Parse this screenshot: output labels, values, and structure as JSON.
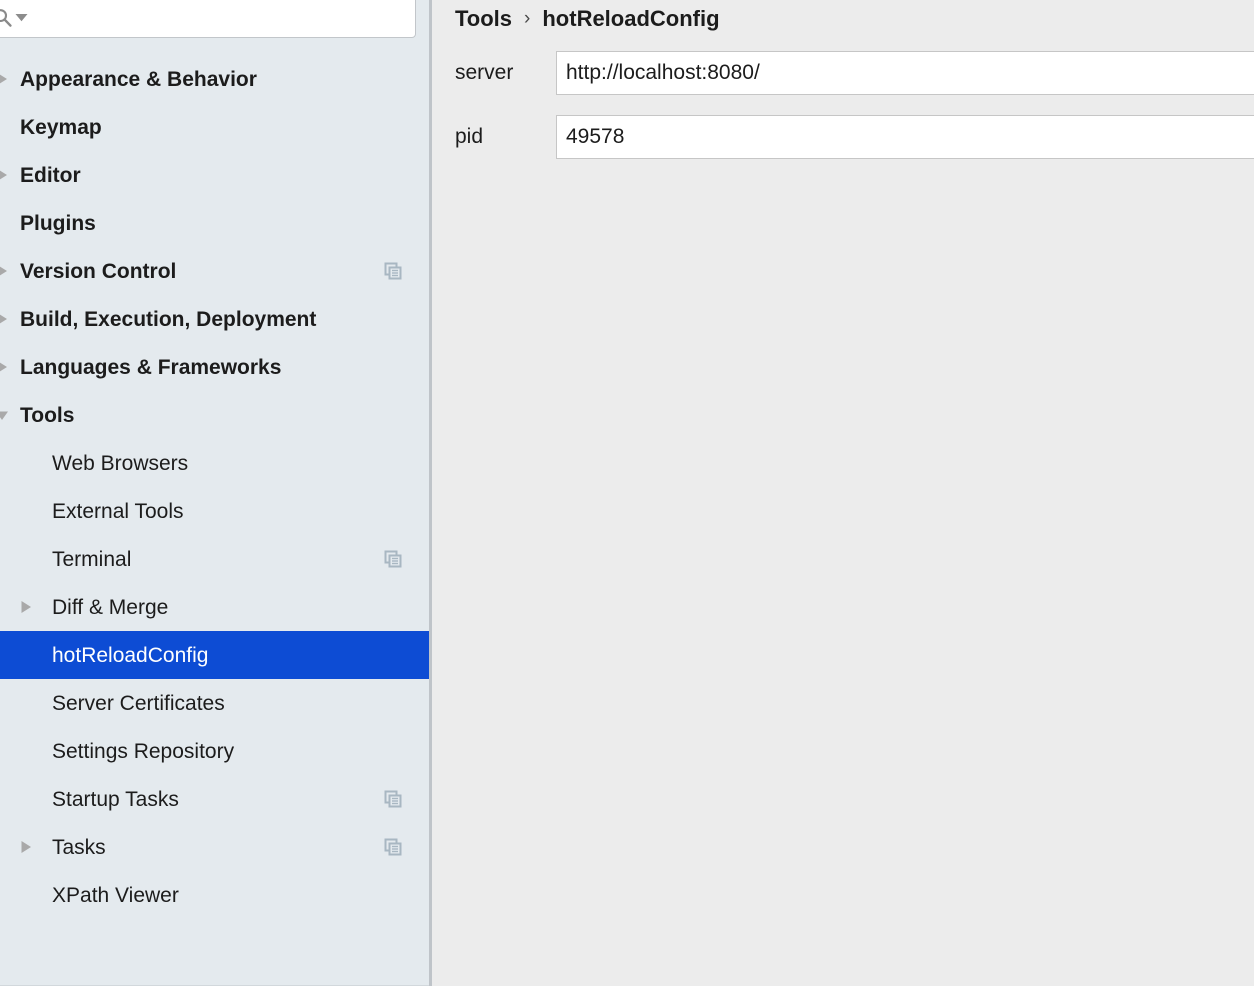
{
  "search": {
    "icon": "search-icon",
    "dropdown_icon": "chevron-down-icon",
    "value": "",
    "placeholder": ""
  },
  "sidebar": {
    "items": [
      {
        "label": "Appearance & Behavior",
        "level": "top",
        "twisty": "collapsed-clipped",
        "scope_icon": false,
        "selected": false
      },
      {
        "label": "Keymap",
        "level": "top",
        "twisty": "none",
        "scope_icon": false,
        "selected": false
      },
      {
        "label": "Editor",
        "level": "top",
        "twisty": "collapsed-clipped",
        "scope_icon": false,
        "selected": false
      },
      {
        "label": "Plugins",
        "level": "top",
        "twisty": "none",
        "scope_icon": false,
        "selected": false
      },
      {
        "label": "Version Control",
        "level": "top",
        "twisty": "collapsed-clipped",
        "scope_icon": true,
        "selected": false
      },
      {
        "label": "Build, Execution, Deployment",
        "level": "top",
        "twisty": "collapsed-clipped",
        "scope_icon": false,
        "selected": false
      },
      {
        "label": "Languages & Frameworks",
        "level": "top",
        "twisty": "collapsed-clipped",
        "scope_icon": false,
        "selected": false
      },
      {
        "label": "Tools",
        "level": "top",
        "twisty": "expanded-clipped",
        "scope_icon": false,
        "selected": false
      },
      {
        "label": "Web Browsers",
        "level": "child",
        "twisty": "none",
        "scope_icon": false,
        "selected": false
      },
      {
        "label": "External Tools",
        "level": "child",
        "twisty": "none",
        "scope_icon": false,
        "selected": false
      },
      {
        "label": "Terminal",
        "level": "child",
        "twisty": "none",
        "scope_icon": true,
        "selected": false
      },
      {
        "label": "Diff & Merge",
        "level": "child",
        "twisty": "collapsed",
        "scope_icon": false,
        "selected": false
      },
      {
        "label": "hotReloadConfig",
        "level": "child",
        "twisty": "none",
        "scope_icon": false,
        "selected": true
      },
      {
        "label": "Server Certificates",
        "level": "child",
        "twisty": "none",
        "scope_icon": false,
        "selected": false
      },
      {
        "label": "Settings Repository",
        "level": "child",
        "twisty": "none",
        "scope_icon": false,
        "selected": false
      },
      {
        "label": "Startup Tasks",
        "level": "child",
        "twisty": "none",
        "scope_icon": true,
        "selected": false
      },
      {
        "label": "Tasks",
        "level": "child",
        "twisty": "collapsed",
        "scope_icon": true,
        "selected": false
      },
      {
        "label": "XPath Viewer",
        "level": "child",
        "twisty": "none",
        "scope_icon": false,
        "selected": false
      }
    ]
  },
  "panel": {
    "breadcrumb": {
      "parent": "Tools",
      "separator": "›",
      "current": "hotReloadConfig"
    },
    "fields": [
      {
        "label": "server",
        "value": "http://localhost:8080/"
      },
      {
        "label": "pid",
        "value": "49578"
      }
    ]
  },
  "colors": {
    "sidebar_background": "#e4eaee",
    "panel_background": "#ececec",
    "selection_blue": "#0d4cd4",
    "selection_text": "#ffffff",
    "text": "#1c1c1c",
    "scope_icon": "#a8b7c2",
    "twisty": "#a9a9a9",
    "divider": "#bfc4c9",
    "input_border": "#c6c6c6",
    "input_background": "#ffffff"
  }
}
